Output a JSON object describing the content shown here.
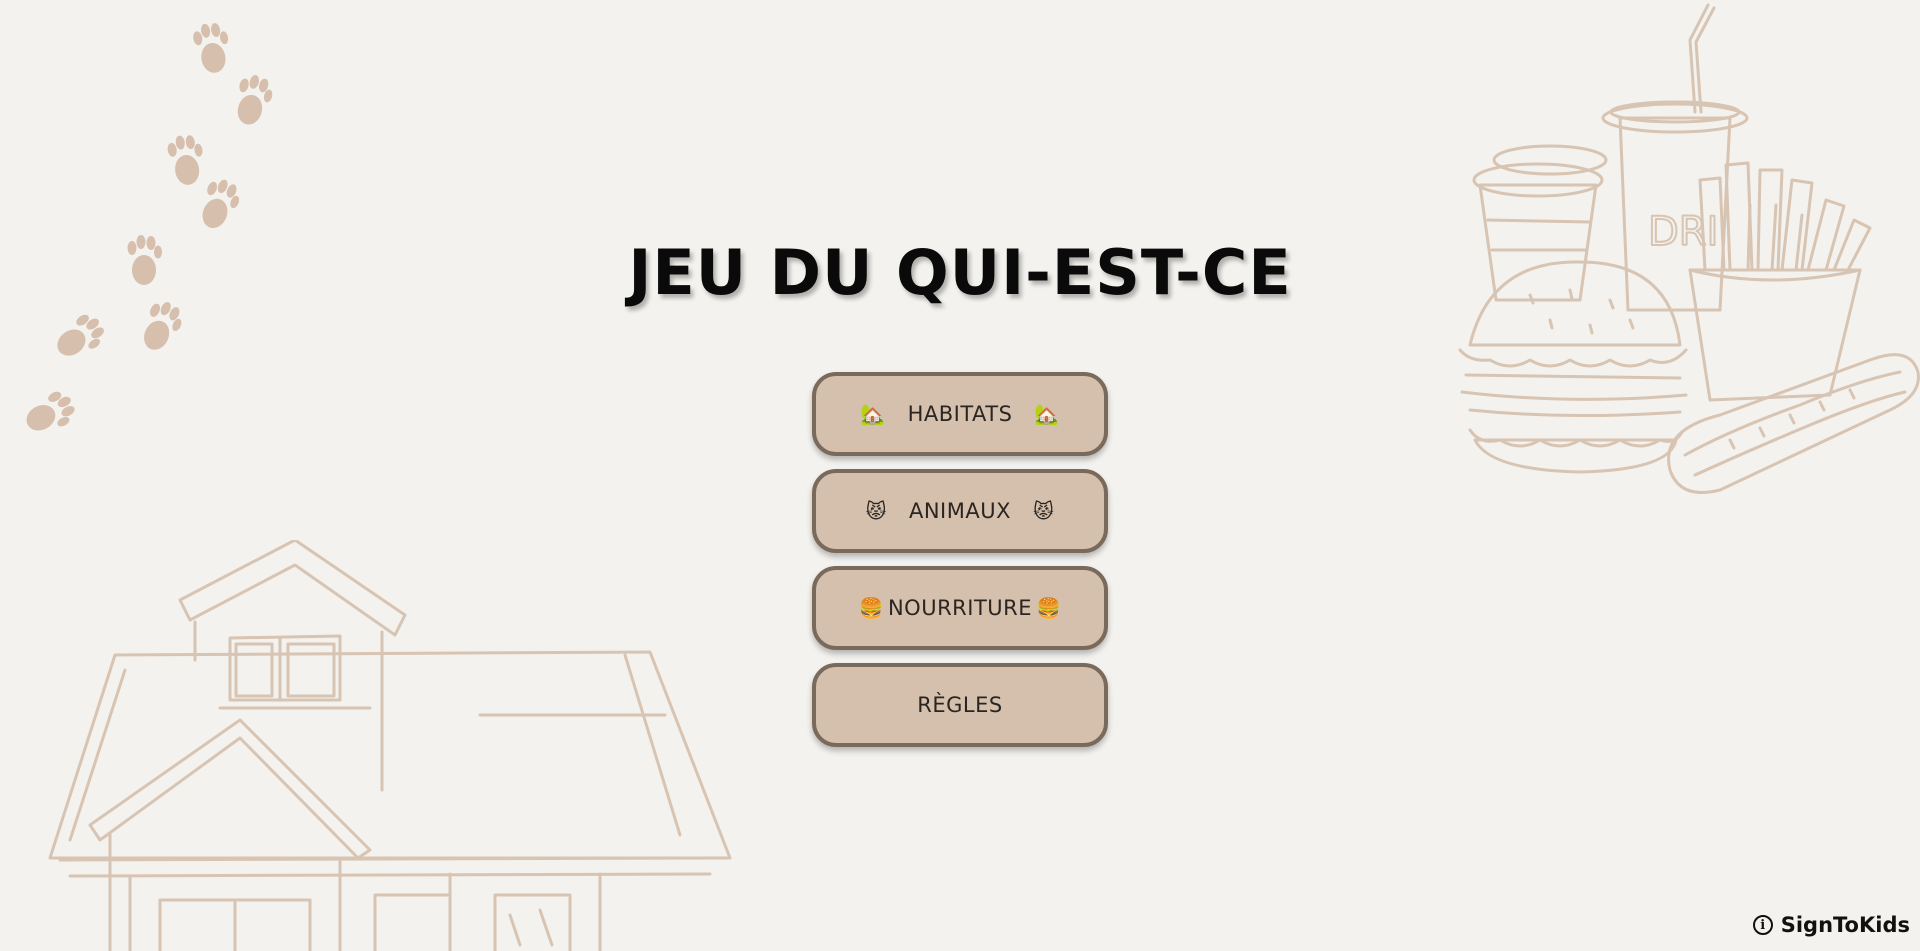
{
  "page": {
    "title": "JEU DU QUI-EST-CE"
  },
  "menu": {
    "items": [
      {
        "label": "HABITATS",
        "emoji_left": "🏡",
        "emoji_right": "🏡",
        "icon": "house-icon"
      },
      {
        "label": "ANIMAUX",
        "emoji_left": "😾",
        "emoji_right": "😾",
        "icon": "cat-icon"
      },
      {
        "label": "NOURRITURE",
        "emoji_left": "🍔",
        "emoji_right": "🍔",
        "icon": "burger-icon"
      },
      {
        "label": "RÈGLES"
      }
    ]
  },
  "footer": {
    "brand": "SignToKids",
    "info_symbol": "i"
  },
  "colors": {
    "background": "#f4f2ee",
    "button_fill": "#d5c0ae",
    "button_border": "#7a6a5c",
    "sketch_lines": "#d8c4b2",
    "paw_prints": "#d7bfae"
  }
}
